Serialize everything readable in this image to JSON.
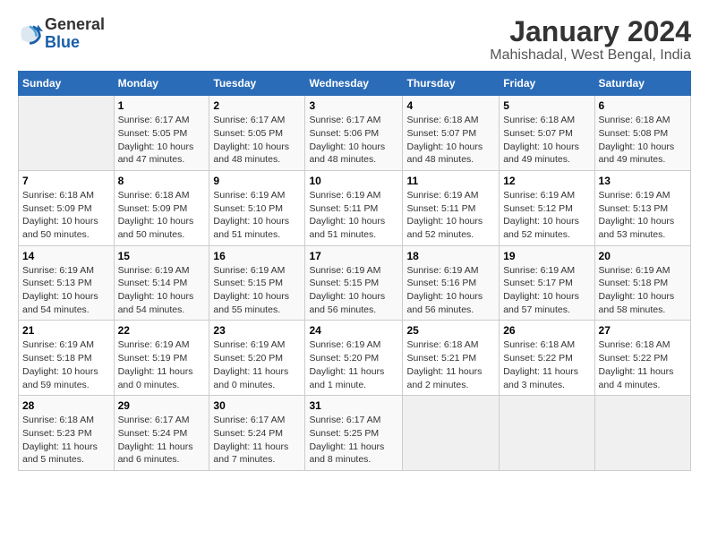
{
  "logo": {
    "line1": "General",
    "line2": "Blue"
  },
  "title": "January 2024",
  "subtitle": "Mahishadal, West Bengal, India",
  "days_of_week": [
    "Sunday",
    "Monday",
    "Tuesday",
    "Wednesday",
    "Thursday",
    "Friday",
    "Saturday"
  ],
  "weeks": [
    [
      {
        "num": "",
        "sunrise": "",
        "sunset": "",
        "daylight": ""
      },
      {
        "num": "1",
        "sunrise": "Sunrise: 6:17 AM",
        "sunset": "Sunset: 5:05 PM",
        "daylight": "Daylight: 10 hours and 47 minutes."
      },
      {
        "num": "2",
        "sunrise": "Sunrise: 6:17 AM",
        "sunset": "Sunset: 5:05 PM",
        "daylight": "Daylight: 10 hours and 48 minutes."
      },
      {
        "num": "3",
        "sunrise": "Sunrise: 6:17 AM",
        "sunset": "Sunset: 5:06 PM",
        "daylight": "Daylight: 10 hours and 48 minutes."
      },
      {
        "num": "4",
        "sunrise": "Sunrise: 6:18 AM",
        "sunset": "Sunset: 5:07 PM",
        "daylight": "Daylight: 10 hours and 48 minutes."
      },
      {
        "num": "5",
        "sunrise": "Sunrise: 6:18 AM",
        "sunset": "Sunset: 5:07 PM",
        "daylight": "Daylight: 10 hours and 49 minutes."
      },
      {
        "num": "6",
        "sunrise": "Sunrise: 6:18 AM",
        "sunset": "Sunset: 5:08 PM",
        "daylight": "Daylight: 10 hours and 49 minutes."
      }
    ],
    [
      {
        "num": "7",
        "sunrise": "Sunrise: 6:18 AM",
        "sunset": "Sunset: 5:09 PM",
        "daylight": "Daylight: 10 hours and 50 minutes."
      },
      {
        "num": "8",
        "sunrise": "Sunrise: 6:18 AM",
        "sunset": "Sunset: 5:09 PM",
        "daylight": "Daylight: 10 hours and 50 minutes."
      },
      {
        "num": "9",
        "sunrise": "Sunrise: 6:19 AM",
        "sunset": "Sunset: 5:10 PM",
        "daylight": "Daylight: 10 hours and 51 minutes."
      },
      {
        "num": "10",
        "sunrise": "Sunrise: 6:19 AM",
        "sunset": "Sunset: 5:11 PM",
        "daylight": "Daylight: 10 hours and 51 minutes."
      },
      {
        "num": "11",
        "sunrise": "Sunrise: 6:19 AM",
        "sunset": "Sunset: 5:11 PM",
        "daylight": "Daylight: 10 hours and 52 minutes."
      },
      {
        "num": "12",
        "sunrise": "Sunrise: 6:19 AM",
        "sunset": "Sunset: 5:12 PM",
        "daylight": "Daylight: 10 hours and 52 minutes."
      },
      {
        "num": "13",
        "sunrise": "Sunrise: 6:19 AM",
        "sunset": "Sunset: 5:13 PM",
        "daylight": "Daylight: 10 hours and 53 minutes."
      }
    ],
    [
      {
        "num": "14",
        "sunrise": "Sunrise: 6:19 AM",
        "sunset": "Sunset: 5:13 PM",
        "daylight": "Daylight: 10 hours and 54 minutes."
      },
      {
        "num": "15",
        "sunrise": "Sunrise: 6:19 AM",
        "sunset": "Sunset: 5:14 PM",
        "daylight": "Daylight: 10 hours and 54 minutes."
      },
      {
        "num": "16",
        "sunrise": "Sunrise: 6:19 AM",
        "sunset": "Sunset: 5:15 PM",
        "daylight": "Daylight: 10 hours and 55 minutes."
      },
      {
        "num": "17",
        "sunrise": "Sunrise: 6:19 AM",
        "sunset": "Sunset: 5:15 PM",
        "daylight": "Daylight: 10 hours and 56 minutes."
      },
      {
        "num": "18",
        "sunrise": "Sunrise: 6:19 AM",
        "sunset": "Sunset: 5:16 PM",
        "daylight": "Daylight: 10 hours and 56 minutes."
      },
      {
        "num": "19",
        "sunrise": "Sunrise: 6:19 AM",
        "sunset": "Sunset: 5:17 PM",
        "daylight": "Daylight: 10 hours and 57 minutes."
      },
      {
        "num": "20",
        "sunrise": "Sunrise: 6:19 AM",
        "sunset": "Sunset: 5:18 PM",
        "daylight": "Daylight: 10 hours and 58 minutes."
      }
    ],
    [
      {
        "num": "21",
        "sunrise": "Sunrise: 6:19 AM",
        "sunset": "Sunset: 5:18 PM",
        "daylight": "Daylight: 10 hours and 59 minutes."
      },
      {
        "num": "22",
        "sunrise": "Sunrise: 6:19 AM",
        "sunset": "Sunset: 5:19 PM",
        "daylight": "Daylight: 11 hours and 0 minutes."
      },
      {
        "num": "23",
        "sunrise": "Sunrise: 6:19 AM",
        "sunset": "Sunset: 5:20 PM",
        "daylight": "Daylight: 11 hours and 0 minutes."
      },
      {
        "num": "24",
        "sunrise": "Sunrise: 6:19 AM",
        "sunset": "Sunset: 5:20 PM",
        "daylight": "Daylight: 11 hours and 1 minute."
      },
      {
        "num": "25",
        "sunrise": "Sunrise: 6:18 AM",
        "sunset": "Sunset: 5:21 PM",
        "daylight": "Daylight: 11 hours and 2 minutes."
      },
      {
        "num": "26",
        "sunrise": "Sunrise: 6:18 AM",
        "sunset": "Sunset: 5:22 PM",
        "daylight": "Daylight: 11 hours and 3 minutes."
      },
      {
        "num": "27",
        "sunrise": "Sunrise: 6:18 AM",
        "sunset": "Sunset: 5:22 PM",
        "daylight": "Daylight: 11 hours and 4 minutes."
      }
    ],
    [
      {
        "num": "28",
        "sunrise": "Sunrise: 6:18 AM",
        "sunset": "Sunset: 5:23 PM",
        "daylight": "Daylight: 11 hours and 5 minutes."
      },
      {
        "num": "29",
        "sunrise": "Sunrise: 6:17 AM",
        "sunset": "Sunset: 5:24 PM",
        "daylight": "Daylight: 11 hours and 6 minutes."
      },
      {
        "num": "30",
        "sunrise": "Sunrise: 6:17 AM",
        "sunset": "Sunset: 5:24 PM",
        "daylight": "Daylight: 11 hours and 7 minutes."
      },
      {
        "num": "31",
        "sunrise": "Sunrise: 6:17 AM",
        "sunset": "Sunset: 5:25 PM",
        "daylight": "Daylight: 11 hours and 8 minutes."
      },
      {
        "num": "",
        "sunrise": "",
        "sunset": "",
        "daylight": ""
      },
      {
        "num": "",
        "sunrise": "",
        "sunset": "",
        "daylight": ""
      },
      {
        "num": "",
        "sunrise": "",
        "sunset": "",
        "daylight": ""
      }
    ]
  ]
}
